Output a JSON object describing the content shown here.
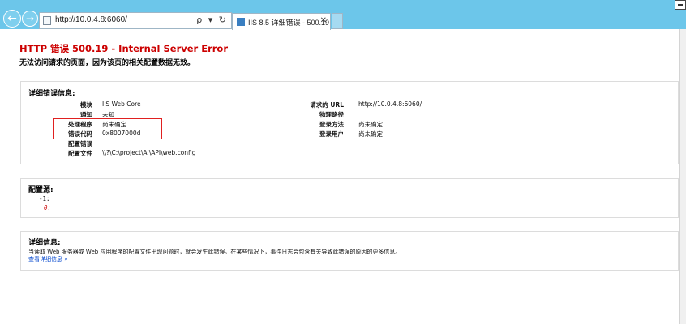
{
  "browser": {
    "url": "http://10.0.4.8:6060/",
    "address_tools": "ρ ▾ ↻",
    "tab_title": "IIS 8.5 详细错误 - 500.19 - ...",
    "tab_close": "✕",
    "back_glyph": "←",
    "forward_glyph": "→"
  },
  "page": {
    "title": "HTTP 错误 500.19 - Internal Server Error",
    "subtitle": "无法访问请求的页面，因为该页的相关配置数据无效。",
    "details": {
      "heading": "详细错误信息:",
      "left_rows": [
        {
          "label": "模块",
          "value": "IIS Web Core"
        },
        {
          "label": "通知",
          "value": "未知"
        },
        {
          "label": "处理程序",
          "value": "尚未确定"
        },
        {
          "label": "错误代码",
          "value": "0x8007000d"
        },
        {
          "label": "配置错误",
          "value": ""
        },
        {
          "label": "配置文件",
          "value": "\\\\?\\C:\\project\\AI\\API\\web.config"
        }
      ],
      "right_rows": [
        {
          "label": "请求的 URL",
          "value": "http://10.0.4.8:6060/"
        },
        {
          "label": "物理路径",
          "value": ""
        },
        {
          "label": "登录方法",
          "value": "尚未确定"
        },
        {
          "label": "登录用户",
          "value": "尚未确定"
        }
      ]
    },
    "config_source": {
      "heading": "配置源:",
      "lines": [
        "-1:",
        "0:"
      ]
    },
    "more_info": {
      "heading": "详细信息:",
      "text": "当读取 Web 服务器或 Web 应用程序的配置文件出现问题时，就会发生此错误。在某些情况下，事件日志会包含有关导致此错误的原因的更多信息。",
      "link": "查看详细信息 »"
    }
  },
  "colors": {
    "chrome": "#6cc6ea",
    "error_title": "#cc0000",
    "highlight_box": "#e02020",
    "link": "#0044cc"
  }
}
